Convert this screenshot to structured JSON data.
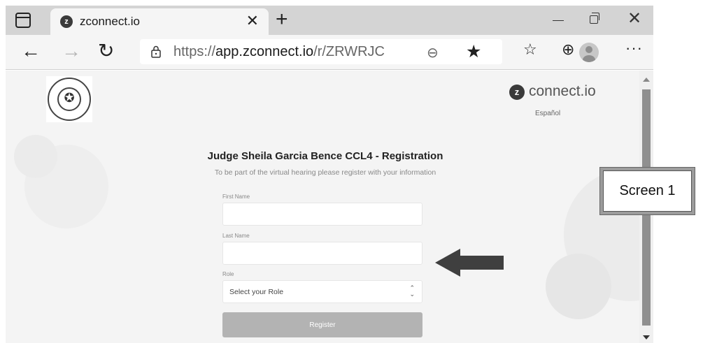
{
  "browser": {
    "tab_title": "zconnect.io",
    "tab_favicon_letter": "z",
    "close_tab_glyph": "✕",
    "new_tab_glyph": "+",
    "url_prefix": "https://",
    "url_host": "app.zconnect.io",
    "url_path": "/r/ZRWRJC",
    "icons": [
      "tab-actions-icon",
      "favicon-icon",
      "close-icon",
      "new-tab-icon",
      "back-icon",
      "forward-icon",
      "reload-icon",
      "lock-icon",
      "zoom-out-icon",
      "star-icon",
      "favorites-icon",
      "collections-icon",
      "profile-icon",
      "more-icon",
      "minimize-icon",
      "maximize-icon"
    ]
  },
  "page": {
    "brand_letter": "z",
    "brand_name": "connect.io",
    "language_link": "Español",
    "heading": "Judge Sheila Garcia Bence CCL4 - Registration",
    "subheading": "To be part of the virtual hearing please register with your information",
    "first_name": {
      "label": "First Name",
      "value": ""
    },
    "last_name": {
      "label": "Last Name",
      "value": ""
    },
    "role": {
      "label": "Role",
      "selected": "Select your Role"
    },
    "register_label": "Register"
  },
  "annotation": {
    "callout_text": "Screen 1",
    "arrow_color": "#3f3f3f"
  },
  "colors": {
    "page_background": "#f4f4f4",
    "register_button": "#b3b3b3",
    "tabstrip": "#d4d4d4"
  }
}
